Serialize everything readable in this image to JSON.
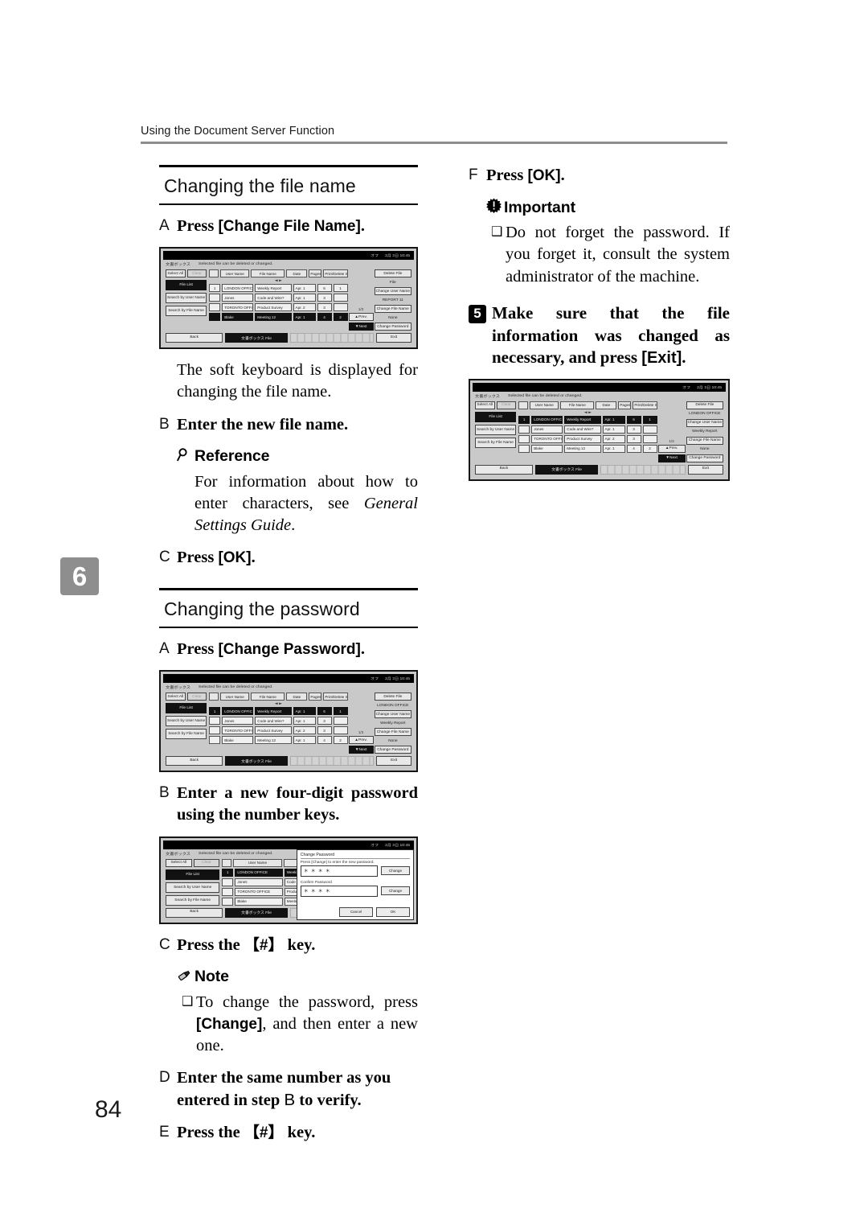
{
  "running_head": "Using the Document Server Function",
  "chapter_tab": "6",
  "folio": "84",
  "left_column": {
    "section_filename": {
      "title": "Changing the file name",
      "steps": [
        {
          "marker": "A",
          "text": "Press ",
          "key": "[Change File Name]",
          "tail": "."
        }
      ],
      "after_image_para": "The soft keyboard is displayed for changing the file name.",
      "step_b": {
        "marker": "B",
        "text": "Enter the new file name."
      },
      "reference": {
        "icon": "magnifier-icon",
        "label": "Reference",
        "body_part1": "For information about how to enter characters, see ",
        "body_italic": "General Settings Guide",
        "body_part2": "."
      },
      "step_c": {
        "marker": "C",
        "text": "Press ",
        "key": "[OK]",
        "tail": "."
      }
    },
    "section_password": {
      "title": "Changing the password",
      "step_a": {
        "marker": "A",
        "text": "Press ",
        "key": "[Change Password]",
        "tail": "."
      },
      "step_b": {
        "marker": "B",
        "text": "Enter a new four-digit password using the number keys."
      },
      "step_c": {
        "marker": "C",
        "text": "Press the ",
        "key": "【#】",
        "tail": " key."
      },
      "note": {
        "icon": "pencil-note-icon",
        "label": "Note",
        "bullet_symbol": "❑",
        "bullet_part1": "To change the password, press ",
        "bullet_key": "[Change]",
        "bullet_part2": ", and then enter a new one."
      },
      "step_d": {
        "marker": "D",
        "text_part1": "Enter the same number as you entered in step ",
        "ref": "B",
        "text_part2": " to verify."
      },
      "step_e": {
        "marker": "E",
        "text": "Press the ",
        "key": "【#】",
        "tail": " key."
      }
    }
  },
  "right_column": {
    "step_f": {
      "marker": "F",
      "text": "Press ",
      "key": "[OK]",
      "tail": "."
    },
    "important": {
      "icon": "important-burst-icon",
      "label": "Important",
      "bullet_symbol": "❑",
      "bullet_text": "Do not forget the password. If you forget it, consult the system administrator of the machine."
    },
    "step_5": {
      "marker": "5",
      "text_part1": "Make sure that the file information was changed as necessary, and press ",
      "key": "[Exit]",
      "tail": "."
    }
  },
  "lcd_common": {
    "status_left": "オフ",
    "status_right": "2月 3日  10:45",
    "header_left": "文書ボックス",
    "header_center": "Selected file can be deleted or changed.",
    "left_buttons": {
      "select_all": "Select All",
      "clear": "Clear",
      "file_list": "File List",
      "search_user": "Search by User Name",
      "search_file": "Search by File Name"
    },
    "columns": [
      "User Name",
      "File Name",
      "Date",
      "Pages",
      "Print/Delete Selected"
    ],
    "rows": [
      {
        "idx": "1",
        "user": "LONDON OFFICE",
        "file": "Weekly Report",
        "date": "Apr. 1",
        "pages": "6",
        "print": "1"
      },
      {
        "idx": "",
        "user": "Jones",
        "file": "Code and Wire?",
        "date": "Apr. 1",
        "pages": "3",
        "print": ""
      },
      {
        "idx": "",
        "user": "TORONTO OFFICE",
        "file": "Product Survey",
        "date": "Apr. 2",
        "pages": "3",
        "print": ""
      },
      {
        "idx": "",
        "user": "Blake",
        "file": "Meeting 12",
        "date": "Apr. 1",
        "pages": "4",
        "print": "2"
      }
    ],
    "right_buttons": {
      "detail": "Delete File",
      "file_hint": "File",
      "change_user": "Change User Name",
      "file_hint2": "REPORT 11",
      "change_file": "Change File Name",
      "pw_hint": "None",
      "change_password": "Change Password"
    },
    "scroll": {
      "count": "1/3",
      "up": "▲Prev.",
      "down": "▼Next"
    },
    "footer": {
      "back": "Back",
      "tab": "文書ボックス File",
      "exit": "Exit"
    },
    "table_arrows": "◄ ►"
  },
  "lcd_password_dialog": {
    "title": "Change Password",
    "message": "Press [Change] to enter the new password.",
    "field1_value": "＊＊＊＊",
    "field1_button": "Change",
    "field2_label": "Confirm Password",
    "field2_value": "＊＊＊＊",
    "field2_button": "Change",
    "cancel": "Cancel",
    "ok": "OK"
  },
  "lcd_selected_states": {
    "shot1_selected_row": 3,
    "shot2_selected_row": 0,
    "shot4_selected_row": 0
  }
}
